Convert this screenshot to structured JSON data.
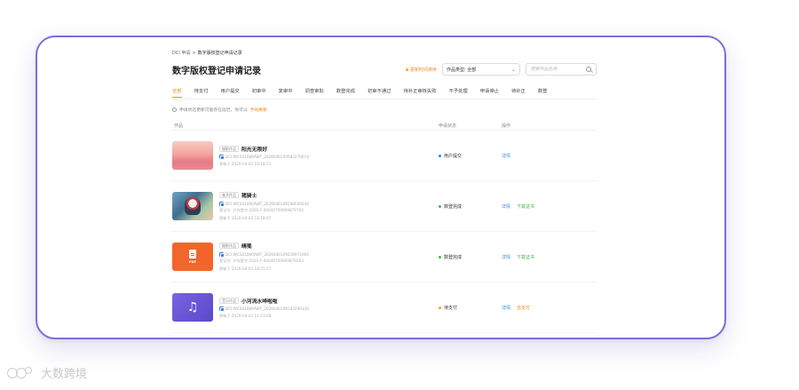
{
  "breadcrumb": {
    "root": "DCI 申请",
    "sep": ">",
    "current": "数字版权登记申请记录"
  },
  "page_title": "数字版权登记申请记录",
  "toolbar": {
    "sort_label": "更新时间排序",
    "type_select_value": "作品类型: 全部",
    "search_placeholder": "搜索作品名称"
  },
  "tabs": [
    {
      "label": "全部",
      "active": true
    },
    {
      "label": "待支付",
      "active": false
    },
    {
      "label": "用户提交",
      "active": false
    },
    {
      "label": "初审中",
      "active": false
    },
    {
      "label": "复审中",
      "active": false
    },
    {
      "label": "调查审批",
      "active": false
    },
    {
      "label": "数登完成",
      "active": false
    },
    {
      "label": "初审不通过",
      "active": false
    },
    {
      "label": "待补正审核失败",
      "active": false
    },
    {
      "label": "不予处理",
      "active": false
    },
    {
      "label": "申请停止",
      "active": false
    },
    {
      "label": "待补正",
      "active": false
    },
    {
      "label": "数登",
      "active": false
    }
  ],
  "notice": {
    "text": "申请状态更新可能存在延迟，你可以",
    "link": "手动刷新"
  },
  "table": {
    "headers": {
      "work": "作品",
      "status": "申请状态",
      "action": "操作"
    },
    "rows": [
      {
        "tag": "摄影作品",
        "name": "阳光无限好",
        "dci_id": "DCI:WCS01000AWT_2026040109582279074",
        "reg_no": "",
        "updated": "更新于 2026-04-02 18:18:21",
        "status": "用户提交",
        "status_color": "#3d7fe0",
        "actions": [
          "详情"
        ]
      },
      {
        "tag": "美术作品",
        "name": "猪骑士",
        "dci_id": "DCI:WCS01000AWT_2026040109198009544",
        "reg_no": "登记号: 沪作登字-2026-F-00040709909879704",
        "updated": "更新于 2026-04-02 18:18:07",
        "status": "数登完成",
        "status_color": "#4caf50",
        "actions": [
          "详情",
          "下载证书"
        ]
      },
      {
        "tag": "摄影作品",
        "name": "晴笺",
        "dci_id": "DCI:WCS01000AWT_2026040109216972082",
        "reg_no": "登记号: 沪作登字-2026-F-00040709909879263",
        "updated": "更新于 2026-04-02 18:21:57",
        "status": "数登完成",
        "status_color": "#4caf50",
        "actions": [
          "详情",
          "下载证书"
        ]
      },
      {
        "tag": "音乐作品",
        "name": "小河流水哗啦啦",
        "dci_id": "DCI:WCS01000AWT_2026040109183290336",
        "reg_no": "",
        "updated": "更新于 2026-04-01 11:23:08",
        "status": "待支付",
        "status_color": "#f5a623",
        "actions": [
          "详情",
          "去支付"
        ]
      }
    ]
  },
  "watermark": {
    "text": "大数跨境"
  },
  "colors": {
    "accent": "#f08a24",
    "frame_border": "#7b6fd6",
    "link": "#3d8de0",
    "success": "#4caf50"
  },
  "icons": [
    "search-icon",
    "chevron-down-icon",
    "info-icon",
    "id-badge-icon",
    "pdf-file-icon",
    "music-note-icon"
  ]
}
